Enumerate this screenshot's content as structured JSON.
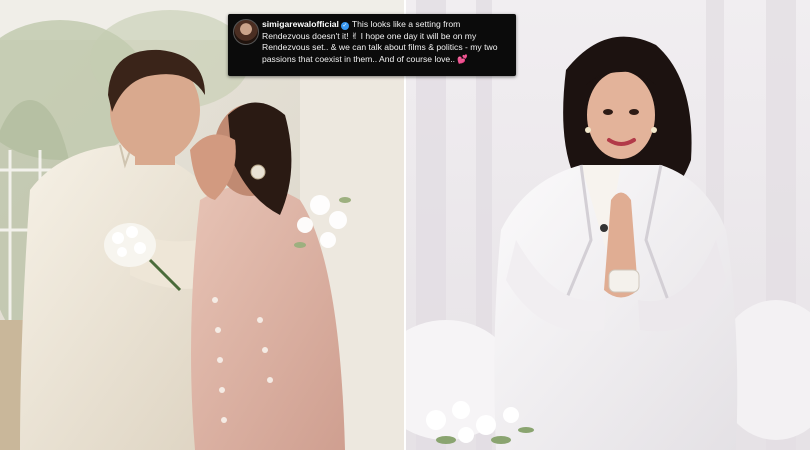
{
  "caption": {
    "username": "simigarewalofficial",
    "verified_mark": "✓",
    "body": "This looks like a setting from Rendezvous doesn't it! ✌ I hope one day it will be on my Rendezvous set.. & we can talk about films & politics - my two passions that coexist in them.. And of course love.. 💕"
  },
  "icons": [
    "avatar",
    "verified-badge-icon"
  ],
  "colors": {
    "caption_bg": "#0b0b0b",
    "caption_text": "#f2f2f2",
    "verified": "#3897f0"
  }
}
